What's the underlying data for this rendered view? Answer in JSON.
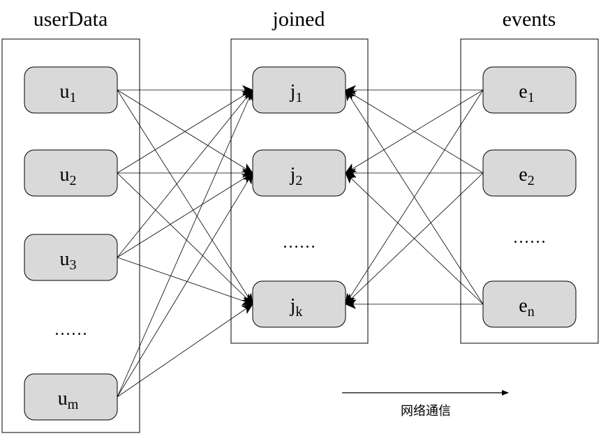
{
  "groups": {
    "userData": {
      "title": "userData",
      "nodes": [
        {
          "base": "u",
          "sub": "1"
        },
        {
          "base": "u",
          "sub": "2"
        },
        {
          "base": "u",
          "sub": "3"
        },
        {
          "base": "u",
          "sub": "m"
        }
      ],
      "ellipsis": "……"
    },
    "joined": {
      "title": "joined",
      "nodes": [
        {
          "base": "j",
          "sub": "1"
        },
        {
          "base": "j",
          "sub": "2"
        },
        {
          "base": "j",
          "sub": "k"
        }
      ],
      "ellipsis": "……"
    },
    "events": {
      "title": "events",
      "nodes": [
        {
          "base": "e",
          "sub": "1"
        },
        {
          "base": "e",
          "sub": "2"
        },
        {
          "base": "e",
          "sub": "n"
        }
      ],
      "ellipsis": "……"
    }
  },
  "legend": {
    "label": "网络通信"
  },
  "colors": {
    "node_fill": "#d9d9d9",
    "stroke": "#000000"
  }
}
